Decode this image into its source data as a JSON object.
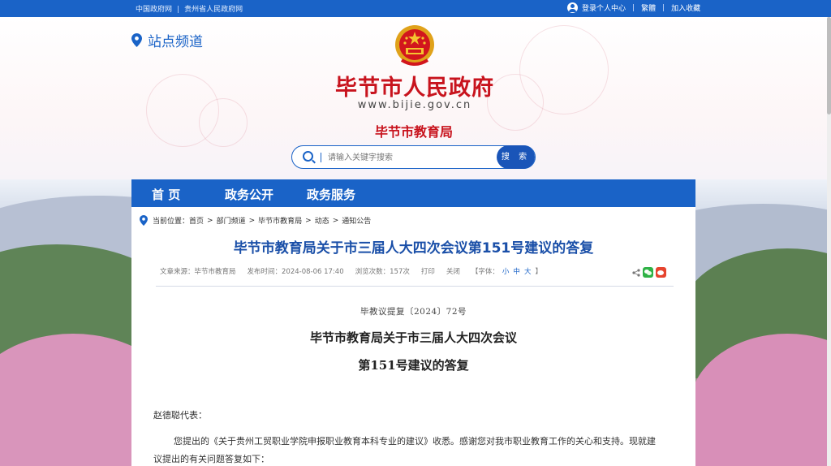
{
  "topbar": {
    "links": [
      "中国政府网",
      "贵州省人民政府网"
    ],
    "login": "登录个人中心",
    "traditional": "繁體",
    "favorite": "加入收藏"
  },
  "header": {
    "site_channel": "站点频道",
    "gov_name": "毕节市人民政府",
    "gov_url": "www.bijie.gov.cn",
    "dept_name": "毕节市教育局"
  },
  "search": {
    "placeholder": "请输入关键字搜索",
    "button": "搜 索"
  },
  "nav": {
    "items": [
      "首 页",
      "政务公开",
      "政务服务"
    ]
  },
  "breadcrumb": {
    "label": "当前位置：",
    "items": [
      "首页",
      "部门频道",
      "毕节市教育局",
      "动态",
      "通知公告"
    ],
    "separator": ">"
  },
  "article": {
    "title": "毕节市教育局关于市三届人大四次会议第151号建议的答复",
    "meta": {
      "source": "文章来源：毕节市教育局",
      "published": "发布时间：2024-08-06 17:40",
      "views": "浏览次数：157次",
      "print": "打印",
      "close": "关闭",
      "fontsize_label": "【字体：",
      "fs_small": "小",
      "fs_mid": "中",
      "fs_big": "大",
      "fontsize_end": "】"
    },
    "doc_number": "毕教议提复〔2024〕72号",
    "doc_title_line1": "毕节市教育局关于市三届人大四次会议",
    "doc_title_line2": "第151号建议的答复",
    "greeting": "赵德聪代表：",
    "paragraph": "您提出的《关于贵州工贸职业学院申报职业教育本科专业的建议》收悉。感谢您对我市职业教育工作的关心和支持。现就建议提出的有关问题答复如下："
  },
  "colors": {
    "primary_blue": "#1a63c7",
    "title_red": "#c8131d",
    "title_blue": "#1a4fa8"
  }
}
